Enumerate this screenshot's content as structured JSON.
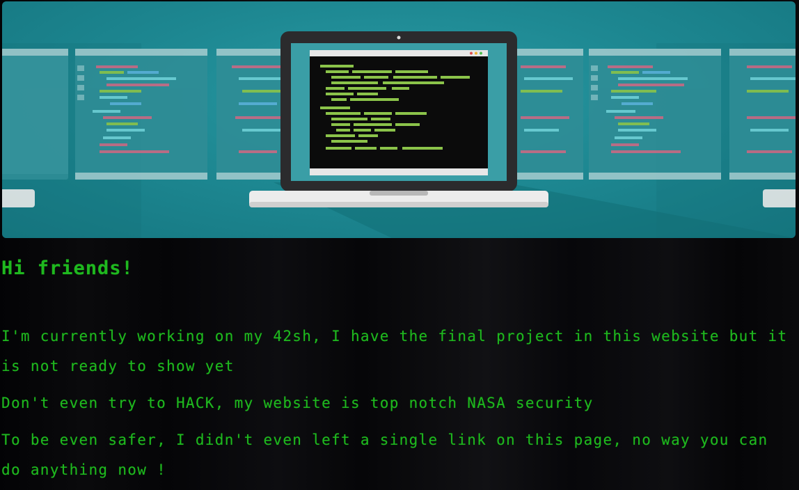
{
  "hero": {
    "colors": {
      "teal": "#1e8993",
      "code_green": "#8bc34a",
      "terminal_bg": "#0b0b0b"
    }
  },
  "content": {
    "heading": "Hi friends!",
    "paragraphs": [
      "I'm currently working on my 42sh, I have the final project in this website but it is not ready to show yet",
      "Don't even try to HACK, my website is top notch NASA security",
      "To be even safer, I didn't even left a single link on this page, no way you can do anything now !"
    ],
    "text_color": "#1fb81f",
    "background_color": "#000000"
  }
}
